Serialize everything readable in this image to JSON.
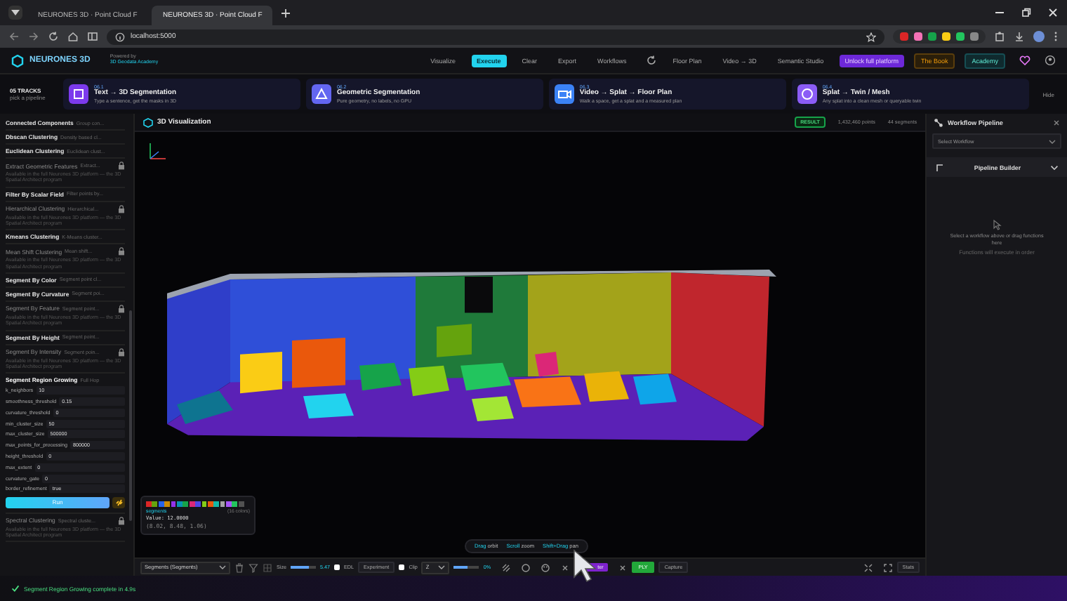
{
  "browser": {
    "tabs": [
      {
        "title": "NEURONES 3D · Point Cloud F",
        "selected": false
      },
      {
        "title": "NEURONES 3D · Point Cloud F",
        "selected": true
      }
    ],
    "address": "localhost:5000"
  },
  "header": {
    "logo": "NEURONES 3D",
    "powered_by": "Powered by",
    "academy": "3D Geodata Academy",
    "nav": [
      {
        "label": "Visualize",
        "kind": "plain"
      },
      {
        "label": "Execute",
        "kind": "primary"
      },
      {
        "label": "Clear",
        "kind": "plain"
      },
      {
        "label": "Export",
        "kind": "plain"
      },
      {
        "label": "Workflows",
        "kind": "plain"
      },
      {
        "kind": "refresh"
      },
      {
        "label": "Floor Plan",
        "kind": "plain"
      },
      {
        "label": "Video → 3D",
        "kind": "plain"
      },
      {
        "label": "Semantic Studio",
        "kind": "plain"
      },
      {
        "label": "Unlock full platform",
        "kind": "promo"
      },
      {
        "label": "The Book",
        "kind": "book"
      },
      {
        "label": "Academy",
        "kind": "academy"
      }
    ]
  },
  "tracks": {
    "label": "05 TRACKS",
    "sublabel": "pick a pipeline",
    "hide": "Hide",
    "cards": [
      {
        "number": "06.1",
        "title": "Text → 3D Segmentation",
        "subtitle": "Type a sentence, get the masks in 3D"
      },
      {
        "number": "06.2",
        "title": "Geometric Segmentation",
        "subtitle": "Pure geometry, no labels, no GPU"
      },
      {
        "number": "06.3",
        "title": "Video → Splat → Floor Plan",
        "subtitle": "Walk a space, get a splat and a measured plan"
      },
      {
        "number": "06.4",
        "title": "Splat → Twin / Mesh",
        "subtitle": "Any splat into a clean mesh or queryable twin"
      }
    ]
  },
  "sidebar": {
    "run_button": "Run",
    "functions": [
      {
        "name": "Connected Components",
        "hint": "Group con...",
        "locked": false,
        "expanded": false
      },
      {
        "name": "Dbscan Clustering",
        "hint": "Density based cl...",
        "locked": false,
        "expanded": false
      },
      {
        "name": "Euclidean Clustering",
        "hint": "Euclidean clust...",
        "locked": false,
        "expanded": false
      },
      {
        "name": "Extract Geometric Features",
        "hint": "Extract...",
        "locked": true,
        "expanded": false,
        "description": "Available in the full Neurones 3D platform — the 3D Spatial Architect program"
      },
      {
        "name": "Filter By Scalar Field",
        "hint": "Filter points by...",
        "locked": false,
        "expanded": false
      },
      {
        "name": "Hierarchical Clustering",
        "hint": "Hierarchical...",
        "locked": true,
        "expanded": false,
        "description": "Available in the full Neurones 3D platform — the 3D Spatial Architect program"
      },
      {
        "name": "Kmeans Clustering",
        "hint": "K-Means cluster...",
        "locked": false,
        "expanded": false
      },
      {
        "name": "Mean Shift Clustering",
        "hint": "Mean shift...",
        "locked": true,
        "expanded": false,
        "description": "Available in the full Neurones 3D platform — the 3D Spatial Architect program"
      },
      {
        "name": "Segment By Color",
        "hint": "Segment point cl...",
        "locked": false,
        "expanded": false
      },
      {
        "name": "Segment By Curvature",
        "hint": "Segment poi...",
        "locked": false,
        "expanded": false
      },
      {
        "name": "Segment By Feature",
        "hint": "Segment point...",
        "locked": true,
        "expanded": false,
        "description": "Available in the full Neurones 3D platform — the 3D Spatial Architect program"
      },
      {
        "name": "Segment By Height",
        "hint": "Segment point...",
        "locked": false,
        "expanded": false
      },
      {
        "name": "Segment By Intensity",
        "hint": "Segment poin...",
        "locked": true,
        "expanded": false,
        "description": "Available in the full Neurones 3D platform — the 3D Spatial Architect program"
      },
      {
        "name": "Segment Region Growing",
        "hint": "Full Hop",
        "locked": false,
        "expanded": true,
        "params": [
          {
            "name": "k_neighbors",
            "value": "10"
          },
          {
            "name": "smoothness_threshold",
            "value": "0.15"
          },
          {
            "name": "curvature_threshold",
            "value": "0"
          },
          {
            "name": "min_cluster_size",
            "value": "50"
          },
          {
            "name": "max_cluster_size",
            "value": "500000"
          },
          {
            "name": "max_points_for_processing",
            "value": "800000"
          },
          {
            "name": "height_threshold",
            "value": "0"
          },
          {
            "name": "max_extent",
            "value": "0"
          },
          {
            "name": "curvature_gate",
            "value": "0"
          },
          {
            "name": "border_refinement",
            "value": "true"
          }
        ]
      },
      {
        "name": "Spectral Clustering",
        "hint": "Spectral cluste...",
        "locked": true,
        "expanded": false,
        "description": "Available in the full Neurones 3D platform — the 3D Spatial Architect program"
      }
    ]
  },
  "viewer": {
    "title": "3D Visualization",
    "badge": "RESULT",
    "points": "1,432,460 points",
    "segments": "44 segments",
    "legend": {
      "swatches": [
        {
          "color": "#dc2626"
        },
        {
          "color": "#65a30d"
        },
        {
          "color": "#2563eb"
        },
        {
          "color": "#ca8a04"
        },
        {
          "color": "#9333ea"
        },
        {
          "color": "#0891b2"
        },
        {
          "color": "#16a34a"
        },
        {
          "color": "#db2777"
        },
        {
          "color": "#4f46e5"
        },
        {
          "color": "#84cc16"
        },
        {
          "color": "#ea580c"
        },
        {
          "color": "#14b8a6"
        },
        {
          "color": "#a3a3a3"
        },
        {
          "color": "#a855f7"
        },
        {
          "color": "#22c55e"
        },
        {
          "color": "#525252"
        }
      ],
      "field": "segments",
      "count": "(16 colors)",
      "value": "Value: 12.0000",
      "coords": "(8.02, 8.48, 1.06)"
    },
    "hints": [
      "**Drag** orbit",
      "**Scroll** zoom",
      "**Shift+Drag** pan"
    ],
    "toolbar": {
      "color_by": "Segments (Segments)",
      "size": {
        "label": "Size",
        "level": 0.7,
        "value": "5.47"
      },
      "edl": {
        "label": "EDL",
        "checked": false
      },
      "experiment": "Experiment",
      "clip": {
        "label": "Clip",
        "checked": false
      },
      "clip_axis": "Z",
      "clip_slider": {
        "level": 0.55,
        "value": "0%"
      },
      "filter": "ter",
      "ply": "PLY",
      "capture": "Capture",
      "stats": "Stats"
    }
  },
  "workflow": {
    "title": "Workflow Pipeline",
    "select": "Select Workflow",
    "builder": "Pipeline Builder",
    "empty": "Select a workflow above or drag functions here",
    "empty_note": "Functions will execute in order"
  },
  "status": "Segment Region Growing complete in 4.9s"
}
